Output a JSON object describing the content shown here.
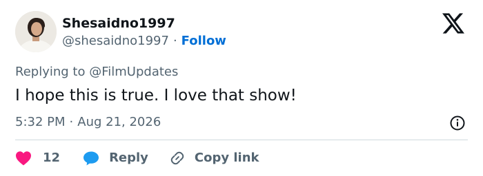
{
  "author": {
    "display_name": "Shesaidno1997",
    "handle": "@shesaidno1997",
    "separator": "·",
    "follow_label": "Follow"
  },
  "tweet": {
    "replying_prefix": "Replying to",
    "replying_to": "@FilmUpdates",
    "text": "I hope this is true. I love that show!",
    "time": "5:32 PM",
    "separator": "·",
    "date": "Aug 21, 2026"
  },
  "actions": {
    "like_count": "12",
    "reply_label": "Reply",
    "copy_link_label": "Copy link"
  },
  "icons": {
    "brand": "x-logo-icon",
    "info": "info-icon",
    "like": "heart-icon",
    "reply": "speech-bubble-icon",
    "copy": "link-icon"
  },
  "colors": {
    "text_primary": "#0f1419",
    "text_secondary": "#536471",
    "follow": "#006fd6",
    "heart": "#f91880",
    "reply_bubble": "#1d9bf0",
    "divider": "#cfd9de"
  }
}
